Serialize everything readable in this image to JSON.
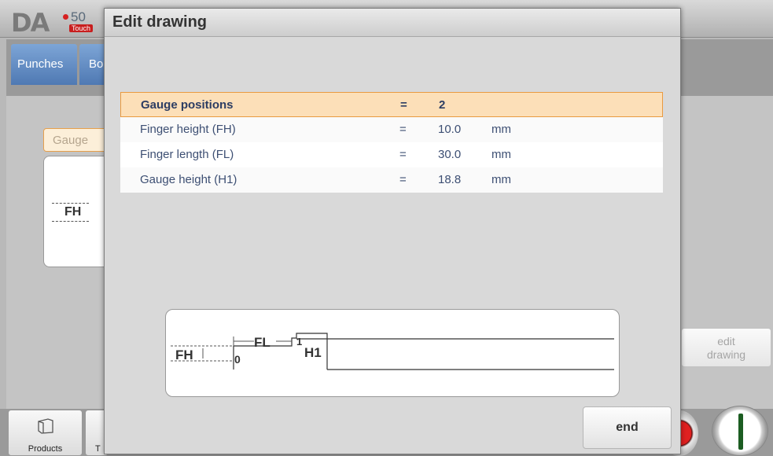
{
  "app": {
    "logo_text": "DA",
    "logo_model": "50",
    "logo_badge": "Touch"
  },
  "background": {
    "tabs": [
      "Punches",
      "Bo"
    ],
    "gauge_label": "Gauge",
    "fh_label": "FH",
    "edit_drawing_label_line1": "edit",
    "edit_drawing_label_line2": "drawing",
    "bottom": {
      "products_label": "Products",
      "t_label": "T"
    }
  },
  "dialog": {
    "title": "Edit drawing",
    "params": [
      {
        "label": "Gauge positions",
        "eq": "=",
        "value": "2",
        "unit": ""
      },
      {
        "label": "Finger height (FH)",
        "eq": "=",
        "value": "10.0",
        "unit": "mm"
      },
      {
        "label": "Finger length (FL)",
        "eq": "=",
        "value": "30.0",
        "unit": "mm"
      },
      {
        "label": "Gauge height (H1)",
        "eq": "=",
        "value": "18.8",
        "unit": "mm"
      }
    ],
    "drawing": {
      "fh": "FH",
      "fl": "FL",
      "h1": "H1",
      "pos0": "0",
      "pos1": "1"
    },
    "end_label": "end"
  },
  "colors": {
    "tab_blue": "#5a84bd",
    "selected_fill": "#fcdfb8",
    "selected_border": "#e99a40",
    "stop_red": "#e02020",
    "start_green": "#1c5d22"
  }
}
